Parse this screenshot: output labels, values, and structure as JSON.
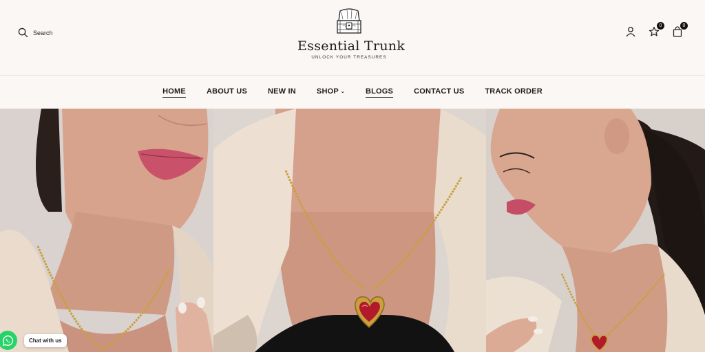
{
  "header": {
    "search_label": "Search",
    "brand_name": "Essential Trunk",
    "brand_tagline": "UNLOCK YOUR TREASURES",
    "wishlist_count": "0",
    "cart_count": "0"
  },
  "nav": {
    "items": [
      {
        "label": "HOME",
        "active": true
      },
      {
        "label": "ABOUT US"
      },
      {
        "label": "NEW IN"
      },
      {
        "label": "SHOP",
        "has_dropdown": true
      },
      {
        "label": "BLOGS",
        "underline": true
      },
      {
        "label": "CONTACT US"
      },
      {
        "label": "TRACK ORDER"
      }
    ]
  },
  "chat": {
    "label": "Chat with us"
  },
  "colors": {
    "background": "#faf7f4",
    "text": "#1e1e1e",
    "whatsapp": "#25d366"
  },
  "icons": [
    "search-icon",
    "treasure-chest-logo",
    "user-icon",
    "wishlist-star-icon",
    "cart-bag-icon",
    "whatsapp-icon"
  ]
}
